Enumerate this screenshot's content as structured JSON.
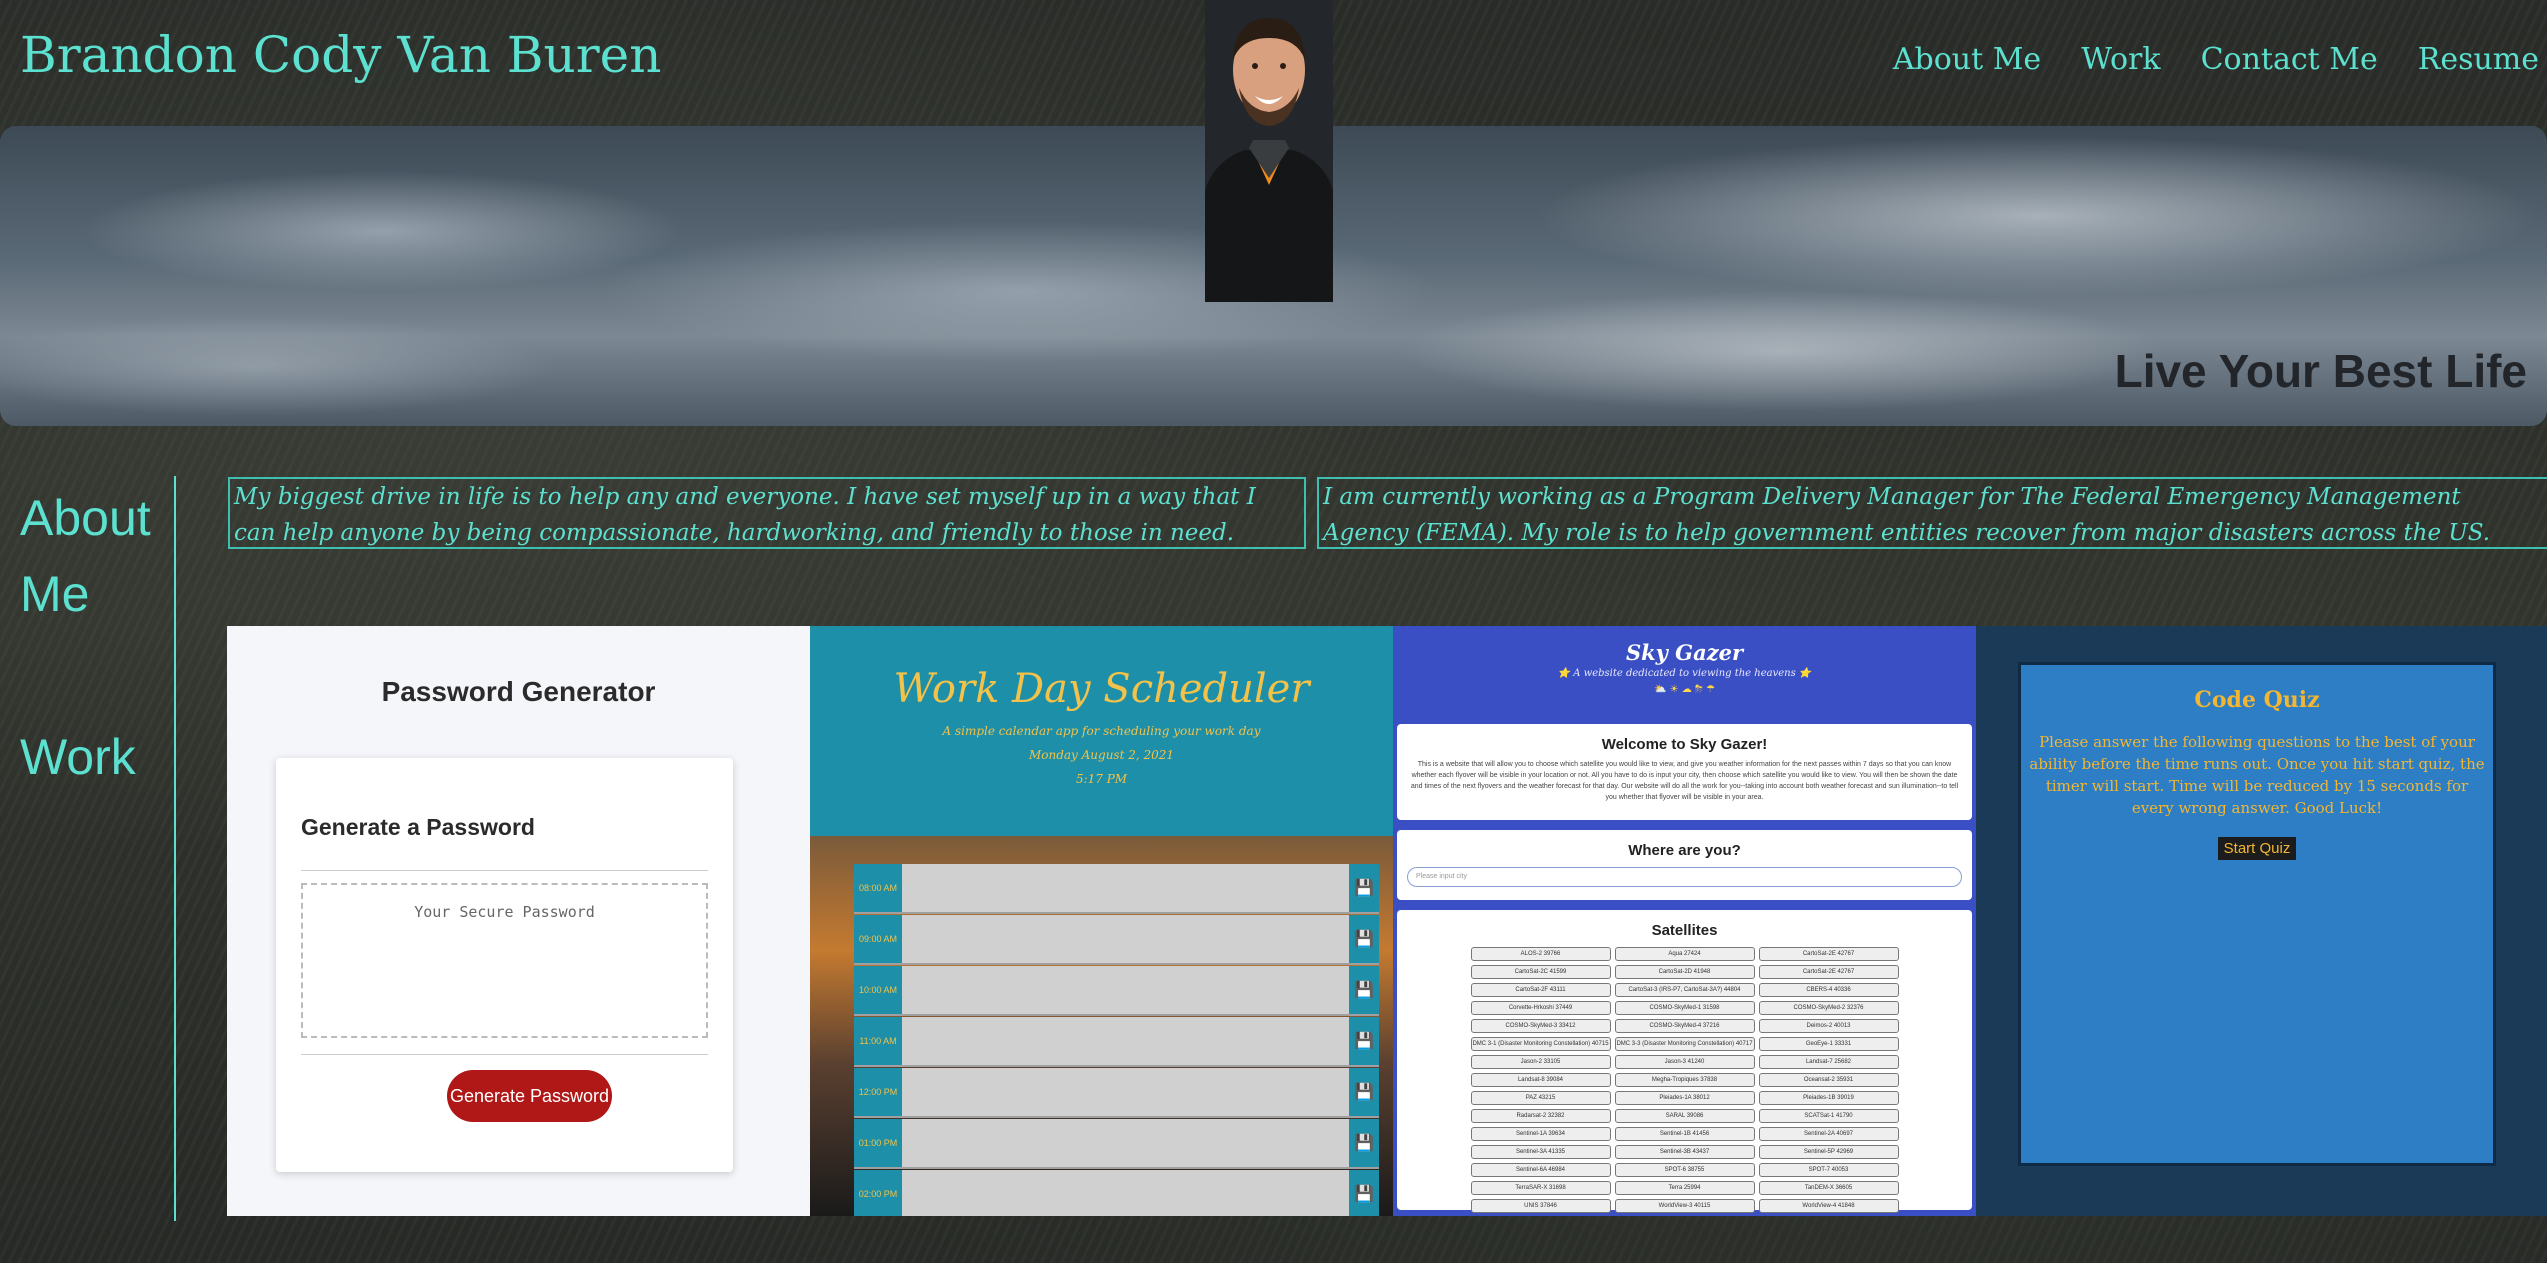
{
  "header": {
    "title": "Brandon Cody Van Buren",
    "nav": [
      "About Me",
      "Work",
      "Contact Me",
      "Resume"
    ]
  },
  "banner": {
    "tagline": "Live Your Best Life"
  },
  "sidebar": {
    "about": "About Me",
    "work": "Work"
  },
  "about": {
    "paragraph_1": "My biggest drive in life is to help any and everyone. I have set myself up in a way that I can help anyone by being compassionate, hardworking, and friendly to those in need.",
    "paragraph_2": "I am currently working as a Program Delivery Manager for The Federal Emergency Management Agency (FEMA). My role is to help government entities recover from major disasters across the US."
  },
  "work": {
    "password_generator": {
      "title": "Password Generator",
      "heading": "Generate a Password",
      "placeholder": "Your Secure Password",
      "button": "Generate Password"
    },
    "scheduler": {
      "title": "Work Day Scheduler",
      "subtitle": "A simple calendar app for scheduling your work day",
      "date": "Monday August 2, 2021",
      "time": "5:17 PM",
      "hours": [
        "08:00 AM",
        "09:00 AM",
        "10:00 AM",
        "11:00 AM",
        "12:00 PM",
        "01:00 PM",
        "02:00 PM"
      ]
    },
    "sky_gazer": {
      "title": "Sky Gazer",
      "subtitle": "⭐ A website dedicated to viewing the heavens ⭐",
      "icons": "⛅ ☀ ☁ ⛈ ☂",
      "welcome": "Welcome to Sky Gazer!",
      "welcome_text": "This is a website that will allow you to choose which satellite you would like to view, and give you weather information for the next passes within 7 days so that you can know whether each flyover will be visible in your location or not. All you have to do is input your city, then choose which satellite you would like to view. You will then be shown the date and times of the next flyovers and the weather forecast for that day. Our website will do all the work for you--taking into account both weather forecast and sun illumination--to tell you whether that flyover will be visible in your area.",
      "where": "Where are you?",
      "input_placeholder": "Please input city",
      "satellites_heading": "Satellites",
      "satellites": [
        "ALOS-2 39766",
        "Aqua 27424",
        "CartoSat-2E 42767",
        "CartoSat-2C 41599",
        "CartoSat-2D 41948",
        "CartoSat-2E 42767",
        "CartoSat-2F 43111",
        "CartoSat-3 (IRS-P7, CartoSat-3A?) 44804",
        "CBERS-4 40336",
        "Corvette-Hrkoshi 37449",
        "COSMO-SkyMed-1 31598",
        "COSMO-SkyMed-2 32376",
        "COSMO-SkyMed-3 33412",
        "COSMO-SkyMed-4 37216",
        "Deimos-2 40013",
        "DMC 3-1 (Disaster Monitoring Constellation) 40715",
        "DMC 3-3 (Disaster Monitoring Constellation) 40717",
        "GeoEye-1 33331",
        "Jason-2 33105",
        "Jason-3 41240",
        "Landsat-7 25682",
        "Landsat-8 39084",
        "Megha-Tropiques 37838",
        "Oceansat-2 35931",
        "PAZ 43215",
        "Pleiades-1A 38012",
        "Pleiades-1B 39019",
        "Radarsat-2 32382",
        "SARAL 39086",
        "SCATSat-1 41790",
        "Sentinel-1A 39634",
        "Sentinel-1B 41456",
        "Sentinel-2A 40697",
        "Sentinel-3A 41335",
        "Sentinel-3B 43437",
        "Sentinel-5P 42969",
        "Sentinel-6A 46984",
        "SPOT-6 38755",
        "SPOT-7 40053",
        "TerraSAR-X 31698",
        "Terra 25994",
        "TanDEM-X 36605",
        "UNIS 37846",
        "WorldView-3 40115",
        "WorldView-4 41848"
      ]
    },
    "code_quiz": {
      "title": "Code Quiz",
      "text": "Please answer the following questions to the best of your ability before the time runs out. Once you hit start quiz, the timer will start. Time will be reduced by 15 seconds for every wrong answer. Good Luck!",
      "button": "Start Quiz"
    }
  },
  "colors": {
    "accent": "#5ce1d0",
    "quiz_gold": "#f2b632",
    "scheduler_teal": "#1e8fa8"
  }
}
